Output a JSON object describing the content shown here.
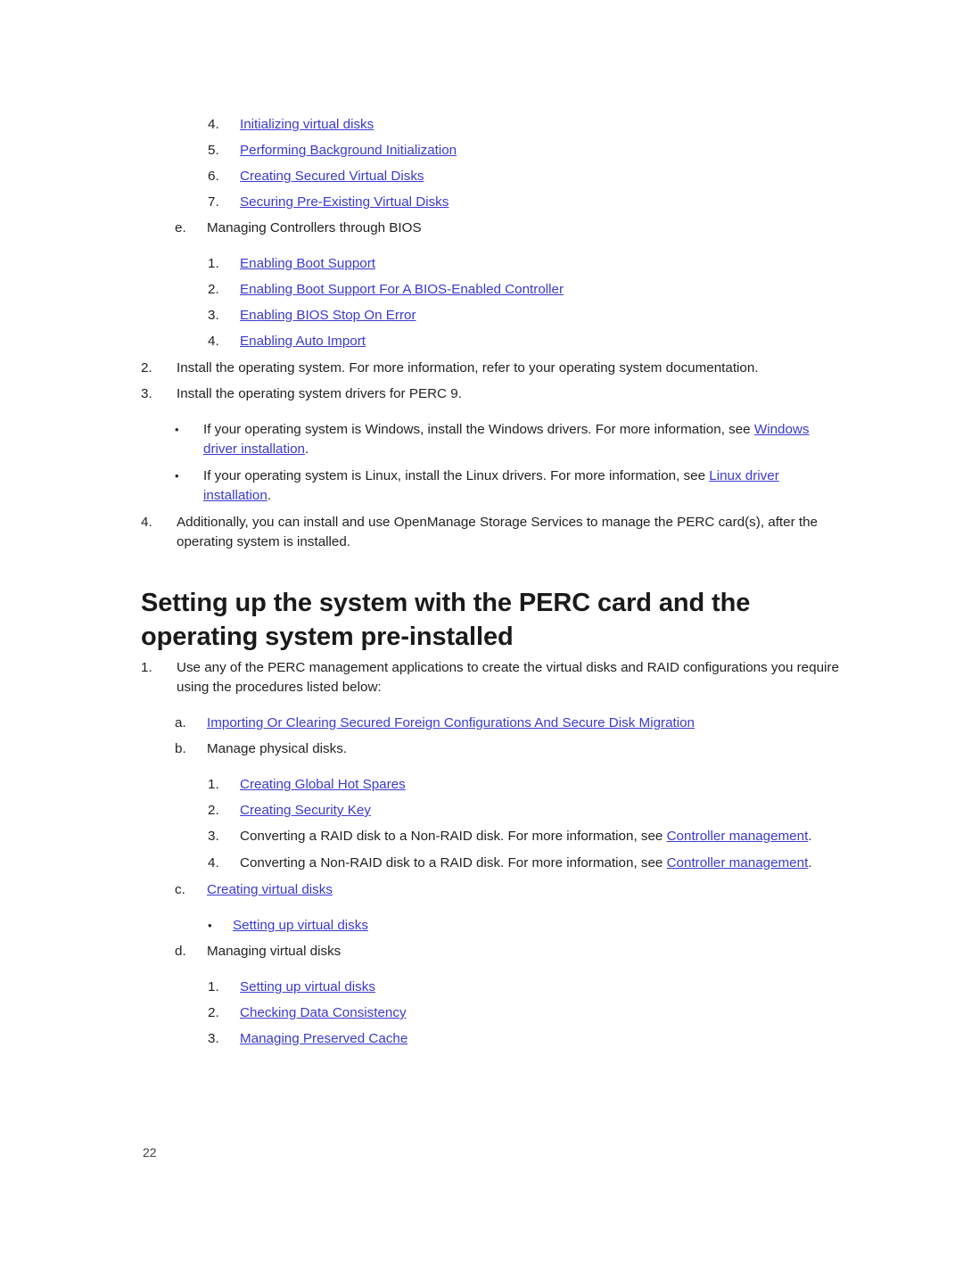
{
  "document": {
    "page_number": "22",
    "link_color": "#3a3ad0",
    "text_color": "#231f20"
  },
  "top_list": {
    "items": [
      {
        "marker": "4.",
        "text": "Initializing virtual disks",
        "link": true
      },
      {
        "marker": "5.",
        "text": "Performing Background Initialization",
        "link": true
      },
      {
        "marker": "6.",
        "text": "Creating Secured Virtual Disks",
        "link": true
      },
      {
        "marker": "7.",
        "text": "Securing Pre-Existing Virtual Disks",
        "link": true
      }
    ],
    "letter_item": {
      "marker": "e.",
      "text": "Managing Controllers through BIOS",
      "link": false
    },
    "sub_items": [
      {
        "marker": "1.",
        "text": "Enabling Boot Support",
        "link": true
      },
      {
        "marker": "2.",
        "text": "Enabling Boot Support For A BIOS-Enabled Controller",
        "link": true
      },
      {
        "marker": "3.",
        "text": "Enabling BIOS Stop On Error",
        "link": true
      },
      {
        "marker": "4.",
        "text": "Enabling Auto Import",
        "link": true
      }
    ]
  },
  "mid_list": {
    "item2": {
      "marker": "2.",
      "text": "Install the operating system. For more information, refer to your operating system documentation."
    },
    "item3": {
      "marker": "3.",
      "text": "Install the operating system drivers for PERC 9."
    },
    "bullets": [
      {
        "marker": "•",
        "pre": "If your operating system is Windows, install the Windows drivers. For more information, see ",
        "link": "Windows driver installation",
        "post": "."
      },
      {
        "marker": "•",
        "pre": "If your operating system is Linux, install the Linux drivers. For more information, see ",
        "link": "Linux driver installation",
        "post": "."
      }
    ],
    "item4": {
      "marker": "4.",
      "text": "Additionally, you can install and use OpenManage Storage Services to manage the PERC card(s), after the operating system is installed."
    }
  },
  "heading": {
    "text": "Setting up the system with the PERC card and the operating system pre-installed"
  },
  "bottom_list": {
    "item1": {
      "marker": "1.",
      "text": "Use any of the PERC management applications to create the virtual disks and RAID configurations you require using the procedures listed below:"
    },
    "item_a": {
      "marker": "a.",
      "text": "Importing Or Clearing Secured Foreign Configurations And Secure Disk Migration",
      "link": true
    },
    "item_b": {
      "marker": "b.",
      "text": "Manage physical disks.",
      "link": false
    },
    "b_subitems": [
      {
        "marker": "1.",
        "text": "Creating Global Hot Spares",
        "link": true
      },
      {
        "marker": "2.",
        "text": "Creating Security Key",
        "link": true
      },
      {
        "marker": "3.",
        "pre": "Converting a RAID disk to a Non-RAID disk. For more information, see ",
        "link": "Controller management",
        "post": "."
      },
      {
        "marker": "4.",
        "pre": "Converting a Non-RAID disk to a RAID disk. For more information, see ",
        "link": "Controller management",
        "post": "."
      }
    ],
    "item_c": {
      "marker": "c.",
      "text": "Creating virtual disks",
      "link": true
    },
    "c_subitems": [
      {
        "marker": "•",
        "text": "Setting up virtual disks",
        "link": true
      }
    ],
    "item_d": {
      "marker": "d.",
      "text": "Managing virtual disks",
      "link": false
    },
    "d_subitems": [
      {
        "marker": "1.",
        "text": "Setting up virtual disks",
        "link": true
      },
      {
        "marker": "2.",
        "text": "Checking Data Consistency",
        "link": true
      },
      {
        "marker": "3.",
        "text": "Managing Preserved Cache",
        "link": true
      }
    ]
  }
}
